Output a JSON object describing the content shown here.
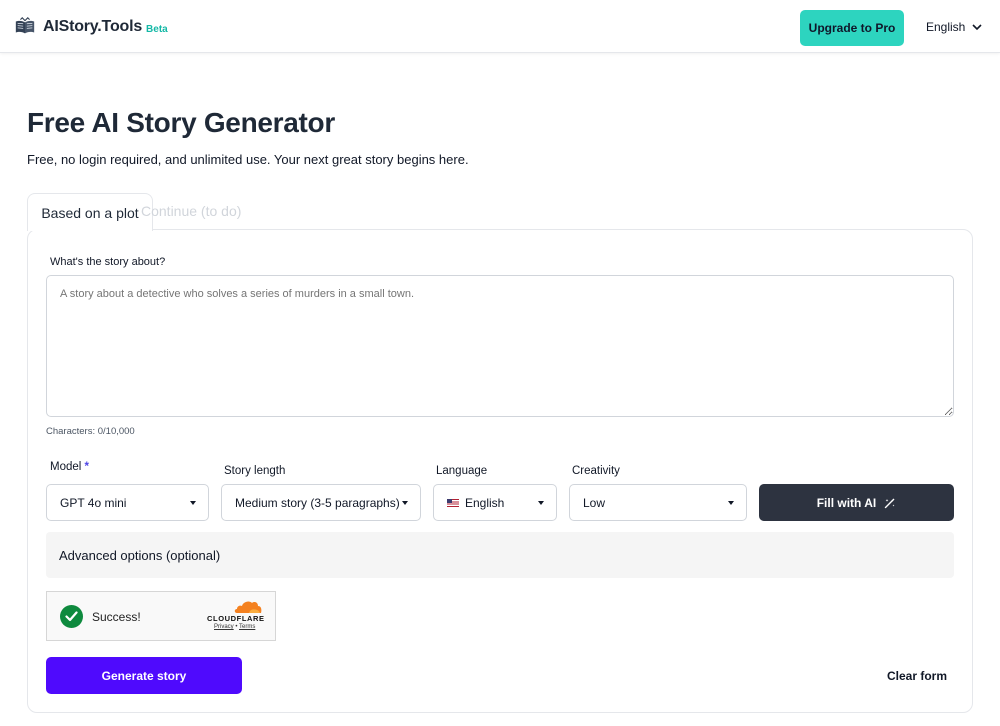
{
  "header": {
    "brand": "AIStory.Tools",
    "beta": "Beta",
    "upgrade_label": "Upgrade to Pro",
    "language": "English",
    "colors": {
      "accent": "#2dd4bf",
      "beta": "#14b8a6"
    }
  },
  "main": {
    "title": "Free AI Story Generator",
    "subtitle": "Free, no login required, and unlimited use. Your next great story begins here.",
    "tabs": [
      {
        "label": "Based on a plot",
        "active": true
      },
      {
        "label": "Continue (to do)",
        "active": false
      }
    ]
  },
  "form": {
    "story_label": "What's the story about?",
    "story_placeholder": "A story about a detective who solves a series of murders in a small town.",
    "story_value": "",
    "char_count": "Characters: 0/10,000",
    "model": {
      "label": "Model",
      "required_mark": "*",
      "value": "GPT 4o mini"
    },
    "length": {
      "label": "Story length",
      "value": "Medium story (3-5 paragraphs)"
    },
    "language": {
      "label": "Language",
      "value": "English",
      "flag_icon": "us-flag-icon"
    },
    "creativity": {
      "label": "Creativity",
      "value": "Low"
    },
    "fill_label": "Fill with AI",
    "advanced_label": "Advanced options (optional)",
    "generate_label": "Generate story",
    "clear_label": "Clear form",
    "colors": {
      "generate": "#4f0afd",
      "fill": "#2d3340"
    }
  },
  "captcha": {
    "status": "Success!",
    "brand": "CLOUDFLARE",
    "privacy": "Privacy",
    "separator": "•",
    "terms": "Terms"
  }
}
